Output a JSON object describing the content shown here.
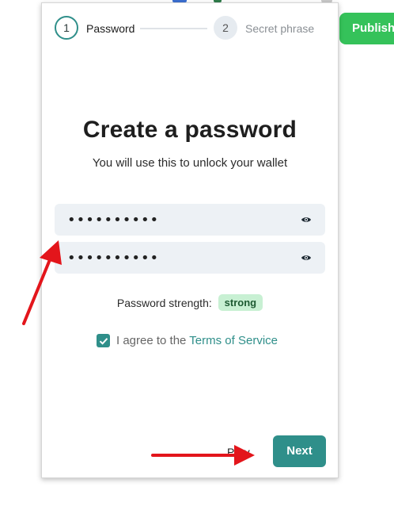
{
  "publish_label": "Publish",
  "stepper": {
    "steps": [
      {
        "number": "1",
        "label": "Password"
      },
      {
        "number": "2",
        "label": "Secret phrase"
      }
    ],
    "active_step": 1
  },
  "header": {
    "title": "Create a password",
    "subtitle": "You will use this to unlock your wallet"
  },
  "fields": {
    "password": "••••••••••",
    "confirm_password": "••••••••••"
  },
  "strength": {
    "label": "Password strength:",
    "value": "strong"
  },
  "terms": {
    "checked": true,
    "prefix": "I agree to the ",
    "link": "Terms of Service"
  },
  "footer": {
    "prev_label": "Prev",
    "next_label": "Next"
  },
  "colors": {
    "accent": "#2f8f8a",
    "publish": "#35c25a",
    "strength_badge_bg": "#c8f0d3",
    "annotation_arrow": "#e3151b"
  },
  "icons": {
    "eye": "eye-icon",
    "checkbox": "check-icon"
  }
}
